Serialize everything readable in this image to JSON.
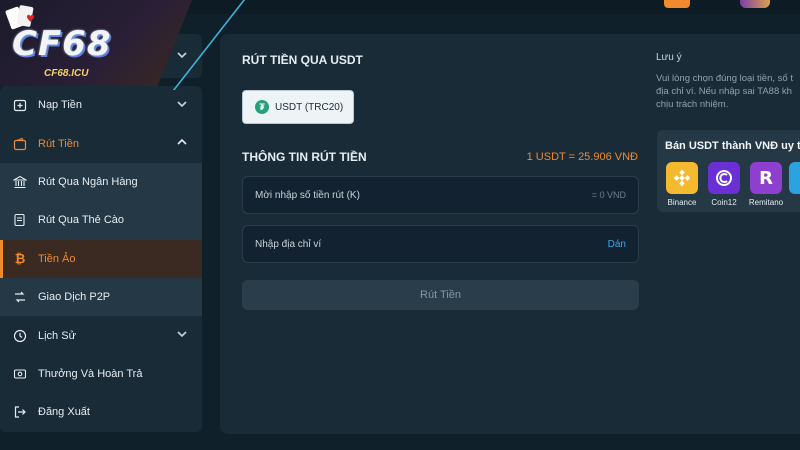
{
  "logo": {
    "brand": "CF68",
    "domain": "CF68.ICU"
  },
  "sidebar": {
    "items": [
      {
        "label": "Nạp Tiền",
        "icon": "deposit-icon",
        "has_chevron": true,
        "chevron": "down"
      },
      {
        "label": "Rút Tiền",
        "icon": "wallet-icon",
        "has_chevron": true,
        "chevron": "up",
        "state": "expanded"
      },
      {
        "label": "Rút Qua Ngân Hàng",
        "icon": "bank-icon",
        "sub": true
      },
      {
        "label": "Rút Qua Thẻ Cào",
        "icon": "card-icon",
        "sub": true
      },
      {
        "label": "Tiền Ảo",
        "icon": "bitcoin-icon",
        "sub": true,
        "state": "active"
      },
      {
        "label": "Giao Dịch P2P",
        "icon": "p2p-icon",
        "sub": true
      },
      {
        "label": "Lịch Sử",
        "icon": "history-icon",
        "has_chevron": true,
        "chevron": "down"
      },
      {
        "label": "Thưởng Và Hoàn Trả",
        "icon": "gift-icon"
      },
      {
        "label": "Đăng Xuất",
        "icon": "logout-icon"
      }
    ]
  },
  "main": {
    "title": "RÚT TIỀN QUA USDT",
    "network_button": "USDT (TRC20)",
    "section_title": "THÔNG TIN RÚT TIỀN",
    "rate": "1 USDT = 25.906 VNĐ",
    "amount_placeholder": "Mời nhập số tiền rút (K)",
    "amount_hint": "= 0 VND",
    "address_placeholder": "Nhập địa chỉ ví",
    "paste_label": "Dán",
    "submit_label": "Rút Tiền"
  },
  "note": {
    "title": "Lưu ý",
    "body": "Vui lòng chọn đúng loại tiền, số t\nđịa chỉ ví. Nếu nhập sai TA88 kh\nchịu trách nhiệm."
  },
  "buy": {
    "title": "Bán USDT thành VNĐ uy t",
    "exchanges": [
      {
        "name": "Binance",
        "color": "#f3ba2f",
        "icon": "binance-icon"
      },
      {
        "name": "Coin12",
        "color": "#6b2fd6",
        "icon": "coin12-icon"
      },
      {
        "name": "Remitano",
        "color": "#8e3fd0",
        "icon": "remitano-icon"
      }
    ]
  },
  "colors": {
    "accent": "#f08a2c",
    "link": "#3fa6e6",
    "panel": "#1a2b38",
    "background": "#10202b"
  }
}
